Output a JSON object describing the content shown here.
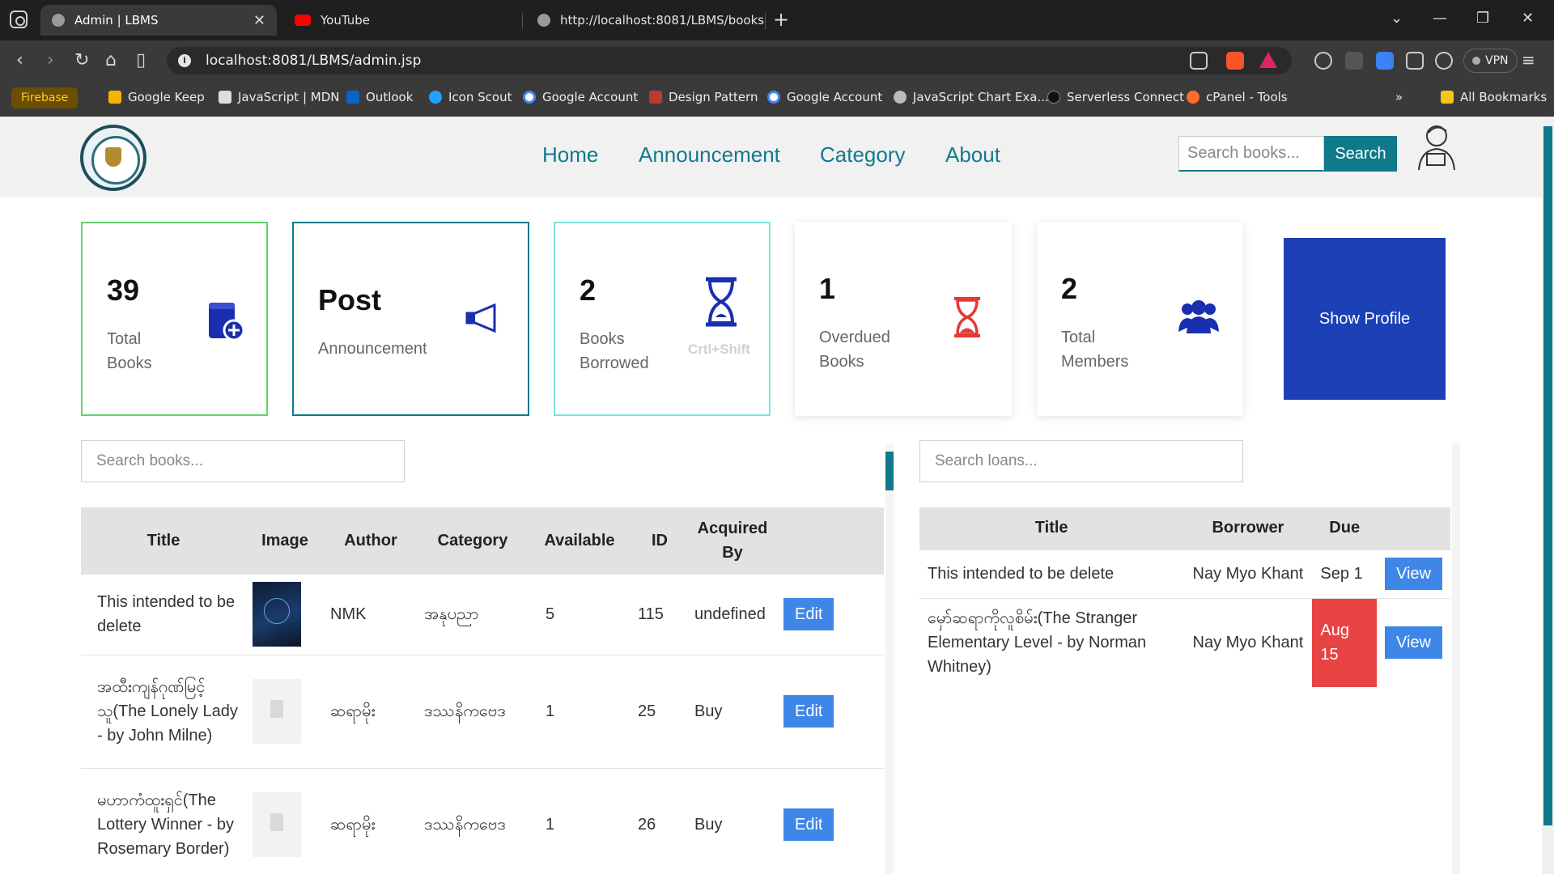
{
  "browser": {
    "tabs": [
      {
        "title": "Admin | LBMS"
      },
      {
        "title": "YouTube"
      },
      {
        "title": "http://localhost:8081/LBMS/books"
      }
    ],
    "url": "localhost:8081/LBMS/admin.jsp",
    "vpn_label": "VPN",
    "bookmarks": [
      "Firebase",
      "Google Keep",
      "JavaScript | MDN",
      "Outlook",
      "Icon Scout",
      "Google Account",
      "Design Pattern",
      "Google Account",
      "JavaScript Chart Exa...",
      "Serverless Connect",
      "cPanel - Tools"
    ],
    "all_bookmarks": "All Bookmarks"
  },
  "header": {
    "nav": [
      "Home",
      "Announcement",
      "Category",
      "About"
    ],
    "search_placeholder": "Search books...",
    "search_button": "Search"
  },
  "cards": {
    "total_books": {
      "value": "39",
      "label_1": "Total",
      "label_2": "Books"
    },
    "announcement": {
      "value": "Post",
      "label": "Announcement"
    },
    "borrowed": {
      "value": "2",
      "label_1": "Books",
      "label_2": "Borrowed",
      "hint": "Crtl+Shift"
    },
    "overdue": {
      "value": "1",
      "label_1": "Overdued",
      "label_2": "Books"
    },
    "members": {
      "value": "2",
      "label_1": "Total",
      "label_2": "Members"
    },
    "profile_button": "Show Profile"
  },
  "books_panel": {
    "search_placeholder": "Search books...",
    "columns": [
      "Title",
      "Image",
      "Author",
      "Category",
      "Available",
      "ID",
      "Acquired By"
    ],
    "edit_label": "Edit",
    "rows": [
      {
        "title": "This intended to be delete",
        "author": "NMK",
        "category": "အနုပညာ",
        "available": "5",
        "id": "115",
        "acquired_by": "undefined"
      },
      {
        "title": "အထီးကျန်ဂုဏ်မြင့်သူ(The Lonely Lady - by John Milne)",
        "author": "ဆရာမိုး",
        "category": "ဒဿနိကဗေဒ",
        "available": "1",
        "id": "25",
        "acquired_by": "Buy"
      },
      {
        "title": "မဟာကံထူးရှင်(The Lottery Winner - by Rosemary Border)",
        "author": "ဆရာမိုး",
        "category": "ဒဿနိကဗေဒ",
        "available": "1",
        "id": "26",
        "acquired_by": "Buy"
      }
    ]
  },
  "loans_panel": {
    "search_placeholder": "Search loans...",
    "columns": [
      "Title",
      "Borrower",
      "Due"
    ],
    "view_label": "View",
    "rows": [
      {
        "title": "This intended to be delete",
        "borrower": "Nay Myo Khant",
        "due": "Sep 1",
        "overdue": false
      },
      {
        "title": "မှော်ဆရာကိုလူစိမ်း(The Stranger Elementary Level - by Norman Whitney)",
        "borrower": "Nay Myo Khant",
        "due": "Aug 15",
        "overdue": true
      }
    ]
  },
  "colors": {
    "accent": "#127a8c",
    "profile": "#1c40b5",
    "edit": "#3e86e8",
    "overdue": "#e84343",
    "icon_blue": "#1a2fb0",
    "icon_red": "#e53935"
  }
}
